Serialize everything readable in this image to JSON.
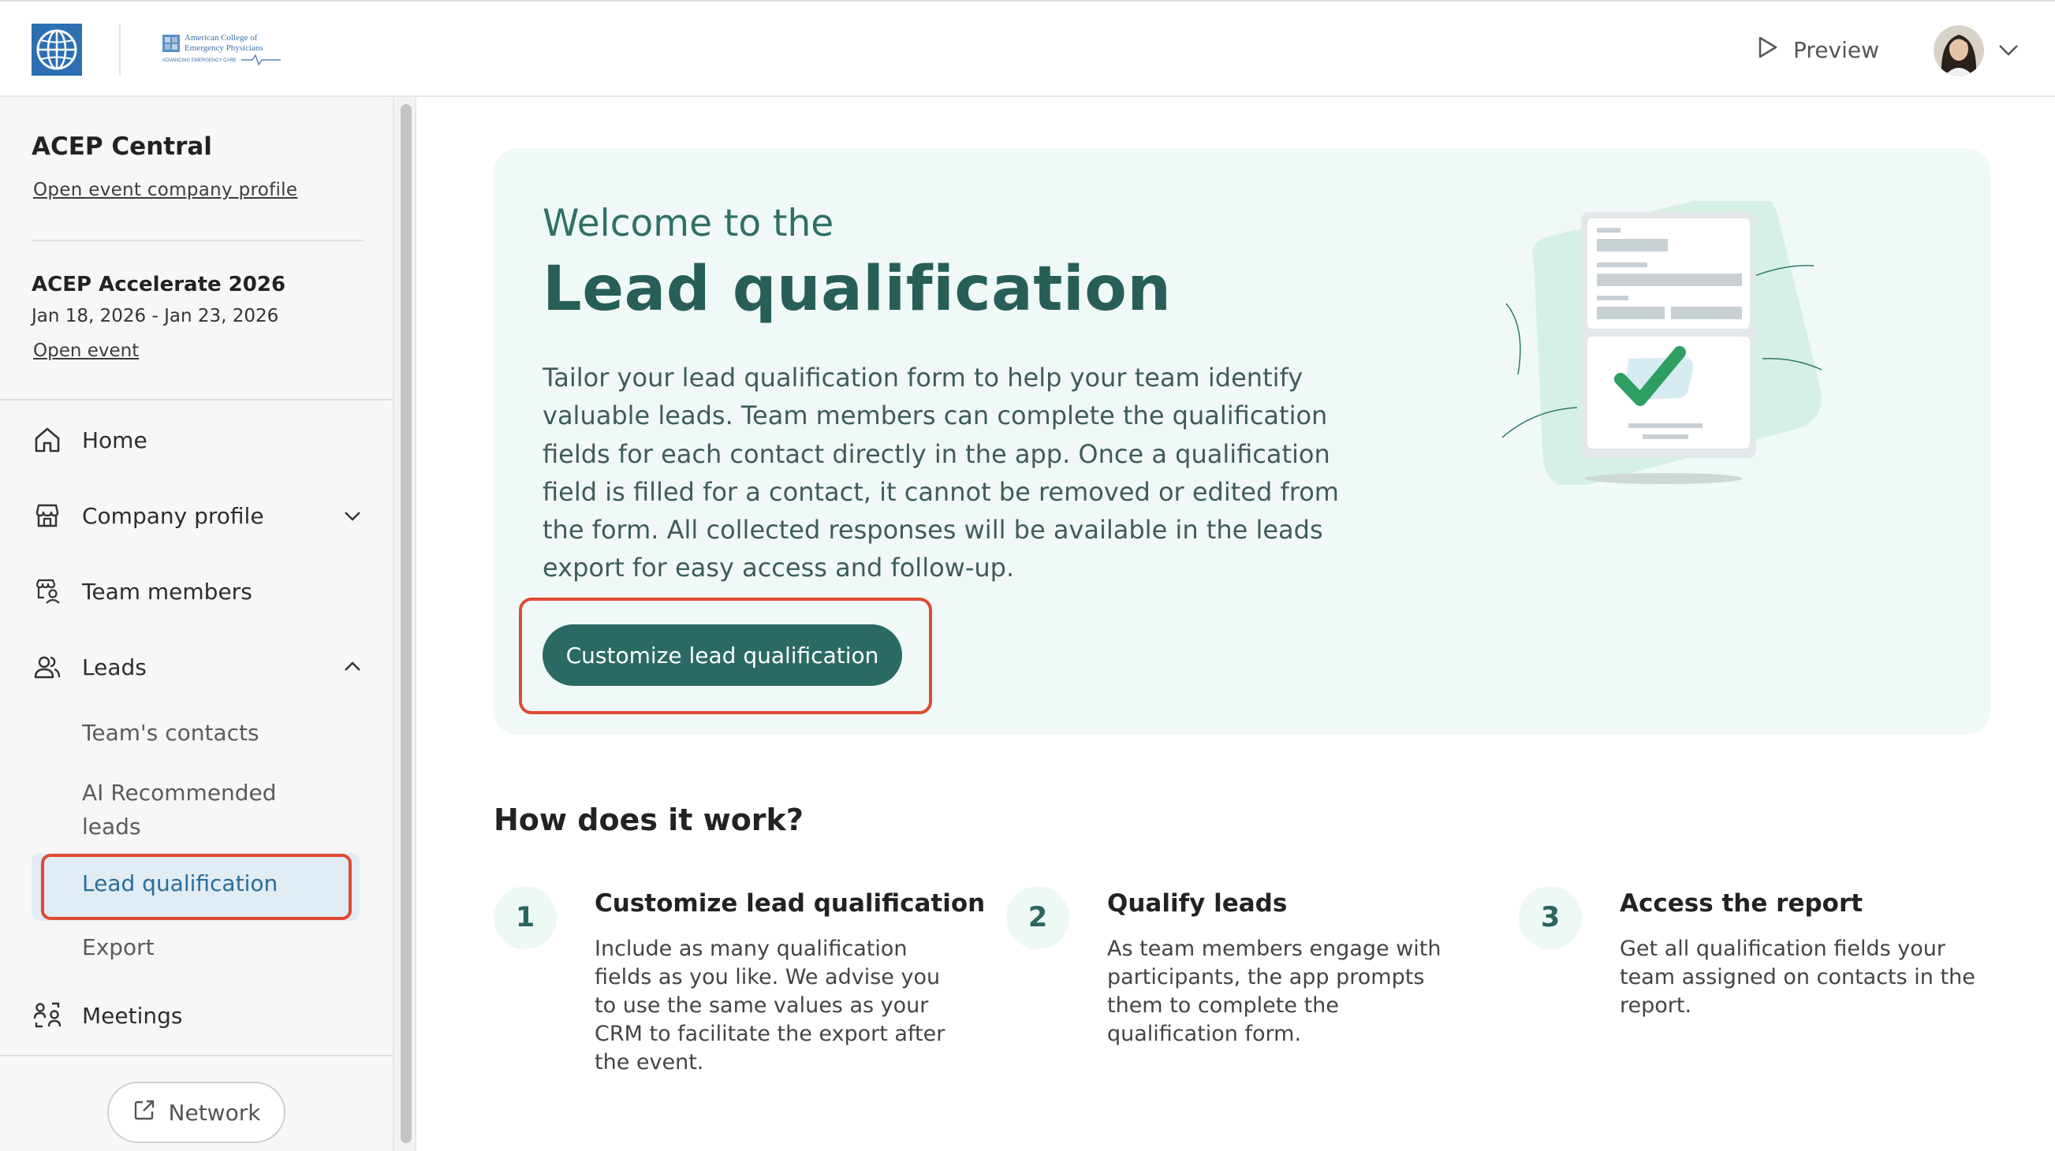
{
  "header": {
    "org_logo": "American College of Emergency Physicians",
    "org_logo_tagline": "ADVANCING EMERGENCY CARE",
    "preview_label": "Preview"
  },
  "sidebar": {
    "company_name": "ACEP Central",
    "company_link": "Open event company profile",
    "event_name": "ACEP Accelerate 2026",
    "event_dates": "Jan 18, 2026 - Jan 23, 2026",
    "event_link": "Open event",
    "nav": {
      "home": "Home",
      "company_profile": "Company profile",
      "team_members": "Team members",
      "leads": "Leads",
      "meetings": "Meetings"
    },
    "leads_sub": {
      "teams_contacts": "Team's contacts",
      "ai_recommended_line1": "AI Recommended",
      "ai_recommended_line2": "leads",
      "lead_qualification": "Lead qualification",
      "export": "Export"
    },
    "network_label": "Network"
  },
  "hero": {
    "kicker": "Welcome to the",
    "title": "Lead qualification",
    "body_lines": [
      "Tailor your lead qualification form to help your team identify",
      "valuable leads. Team members can complete the qualification",
      "fields for each contact directly in the app. Once a qualification",
      "field is filled for a contact, it cannot be removed or edited from",
      "the form. All collected responses will be available in the leads",
      "export for easy access and follow-up."
    ],
    "cta_label": "Customize lead qualification"
  },
  "how": {
    "title": "How does it work?",
    "steps": [
      {
        "num": "1",
        "title": "Customize lead qualification",
        "lines": [
          "Include as many qualification",
          "fields as you like. We advise you",
          "to use the same values as your",
          "CRM to facilitate the export after",
          "the event."
        ]
      },
      {
        "num": "2",
        "title": "Qualify leads",
        "lines": [
          "As team members engage with",
          "participants, the app prompts",
          "them to complete the",
          "qualification form."
        ]
      },
      {
        "num": "3",
        "title": "Access the report",
        "lines": [
          "Get all qualification fields your",
          "team assigned on contacts in the",
          "report."
        ]
      }
    ]
  },
  "colors": {
    "brand_teal": "#2b6a64",
    "hero_bg": "#f0f9f7",
    "active_nav_bg": "#e1ecf5",
    "active_nav_text": "#2a6d9a",
    "highlight_outline": "#e04a32"
  },
  "icons": [
    "globe-logo-icon",
    "play-icon",
    "chevron-down-icon",
    "home-icon",
    "storefront-icon",
    "team-badge-icon",
    "users-icon",
    "chevron-up-icon",
    "meetings-icon",
    "external-link-icon"
  ]
}
